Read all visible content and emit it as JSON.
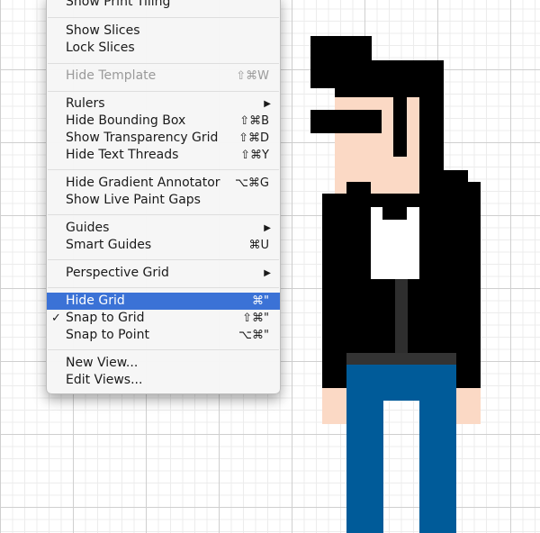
{
  "menu": {
    "items": [
      {
        "label": "Show Print Tiling",
        "shortcut": ""
      },
      {
        "label": "Show Slices",
        "shortcut": ""
      },
      {
        "label": "Lock Slices",
        "shortcut": ""
      },
      {
        "label": "Hide Template",
        "shortcut": "⇧⌘W"
      },
      {
        "label": "Rulers",
        "shortcut": "",
        "arrow": "▶"
      },
      {
        "label": "Hide Bounding Box",
        "shortcut": "⇧⌘B"
      },
      {
        "label": "Show Transparency Grid",
        "shortcut": "⇧⌘D"
      },
      {
        "label": "Hide Text Threads",
        "shortcut": "⇧⌘Y"
      },
      {
        "label": "Hide Gradient Annotator",
        "shortcut": "⌥⌘G"
      },
      {
        "label": "Show Live Paint Gaps",
        "shortcut": ""
      },
      {
        "label": "Guides",
        "shortcut": "",
        "arrow": "▶"
      },
      {
        "label": "Smart Guides",
        "shortcut": "⌘U"
      },
      {
        "label": "Perspective Grid",
        "shortcut": "",
        "arrow": "▶"
      },
      {
        "label": "Hide Grid",
        "shortcut": "⌘\""
      },
      {
        "label": "Snap to Grid",
        "shortcut": "⇧⌘\"",
        "check": "✓"
      },
      {
        "label": "Snap to Point",
        "shortcut": "⌥⌘\""
      },
      {
        "label": "New View...",
        "shortcut": ""
      },
      {
        "label": "Edit Views...",
        "shortcut": ""
      }
    ]
  },
  "colors": {
    "hair": "#000000",
    "skin": "#fbd9c5",
    "jacket": "#000000",
    "shirt": "#ffffff",
    "tie": "#2e2e2e",
    "belt": "#333333",
    "jeans": "#005b99",
    "highlight": "#3b72d6"
  }
}
